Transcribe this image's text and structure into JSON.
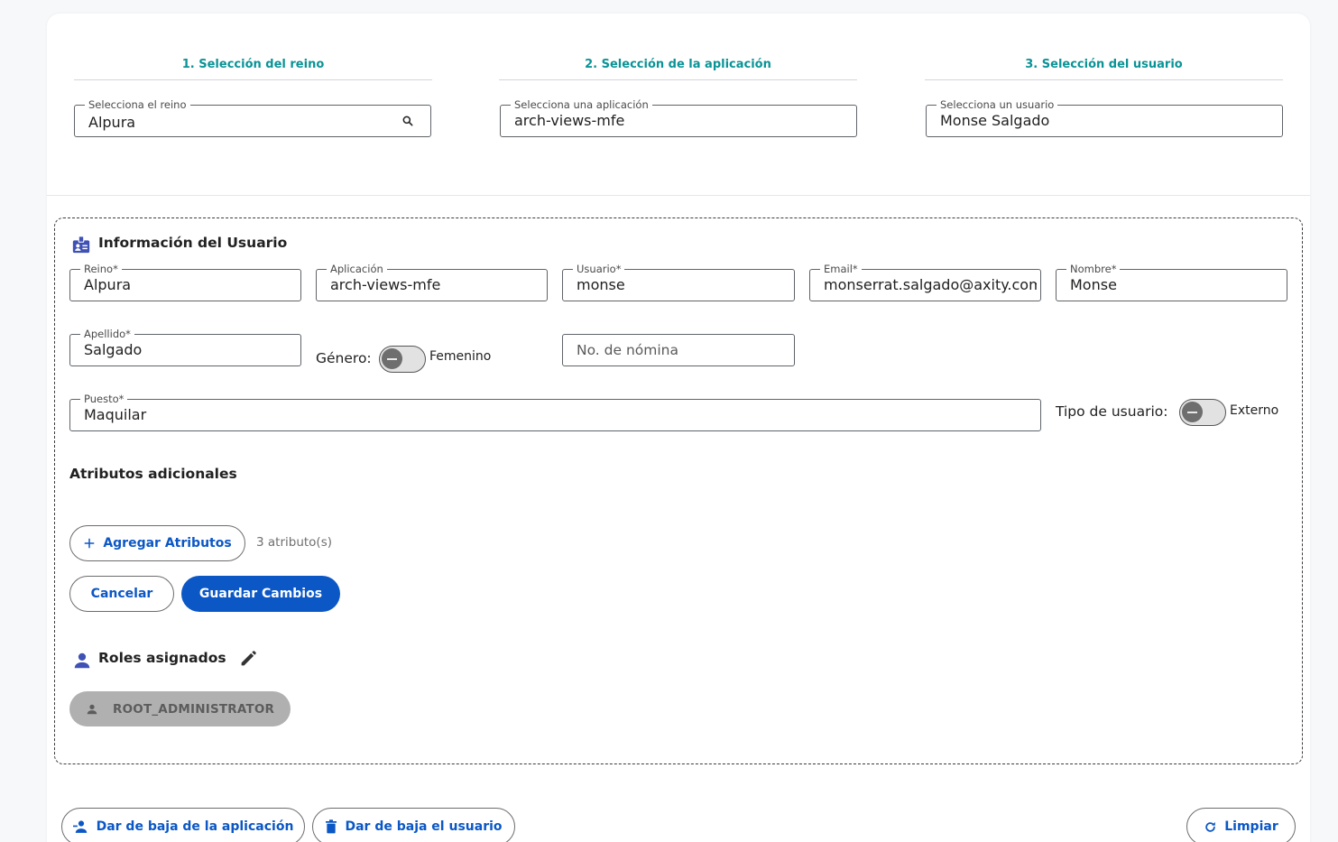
{
  "steps": [
    {
      "title": "1. Selección del reino",
      "field_label": "Selecciona el reino",
      "value": "Alpura"
    },
    {
      "title": "2. Selección de la aplicación",
      "field_label": "Selecciona una aplicación",
      "value": "arch-views-mfe"
    },
    {
      "title": "3. Selección del usuario",
      "field_label": "Selecciona un usuario",
      "value": "Monse Salgado"
    }
  ],
  "user_info": {
    "heading": "Información del Usuario",
    "fields": {
      "realm": {
        "label": "Reino*",
        "value": "Alpura"
      },
      "application": {
        "label": "Aplicación",
        "value": "arch-views-mfe"
      },
      "username": {
        "label": "Usuario*",
        "value": "monse"
      },
      "email": {
        "label": "Email*",
        "value": "monserrat.salgado@axity.com"
      },
      "name": {
        "label": "Nombre*",
        "value": "Monse"
      },
      "surname": {
        "label": "Apellido*",
        "value": "Salgado"
      },
      "payroll": {
        "placeholder": "No. de nómina"
      },
      "position": {
        "label": "Puesto*",
        "value": "Maquilar"
      }
    },
    "gender": {
      "label": "Género:",
      "toggle_text": "Femenino"
    },
    "user_type": {
      "label": "Tipo de usuario:",
      "toggle_text": "Externo"
    }
  },
  "attributes": {
    "heading": "Atributos adicionales",
    "add_button": "Agregar Atributos",
    "count_text": "3 atributo(s)"
  },
  "form_actions": {
    "cancel": "Cancelar",
    "save": "Guardar Cambios"
  },
  "roles": {
    "heading": "Roles asignados",
    "items": [
      "ROOT_ADMINISTRATOR"
    ]
  },
  "footer": {
    "deactivate_app": "Dar de baja de la aplicación",
    "deactivate_user": "Dar de baja el usuario",
    "clear": "Limpiar"
  },
  "colors": {
    "step_title": "#0a9396",
    "primary": "#0b57c5",
    "icon_indigo": "#3f51b5",
    "chip_bg": "#b0b0b0"
  },
  "icons": [
    "search-icon",
    "badge-icon",
    "person-icon",
    "edit-icon",
    "plus-icon",
    "remove-person-icon",
    "trash-icon",
    "refresh-icon"
  ]
}
